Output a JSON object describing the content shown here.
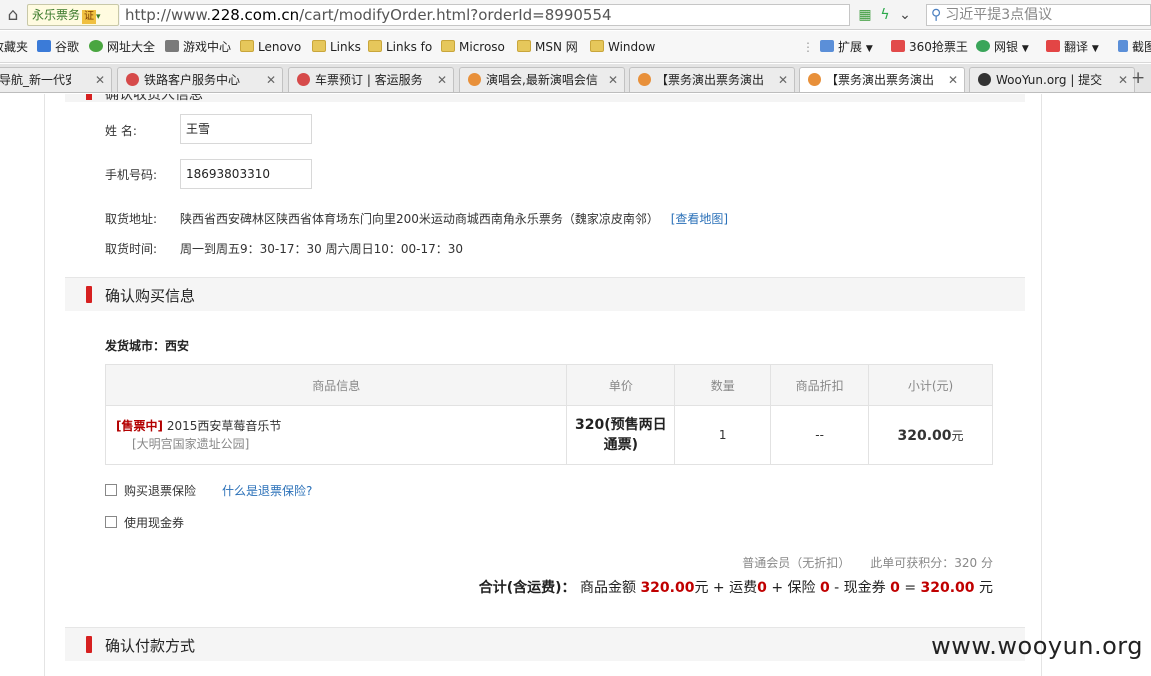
{
  "browser": {
    "site_badge": "永乐票务",
    "cert_label": "证",
    "url_prefix": "http://www.",
    "url_host": "228.com.cn",
    "url_path": "/cart/modifyOrder.html?orderId=8990554",
    "search_text": "习近平提3点倡议",
    "bookmarks": [
      {
        "label": "收藏夹",
        "icon": "star-icon"
      },
      {
        "label": "谷歌",
        "icon": "google-icon"
      },
      {
        "label": "网址大全",
        "icon": "site-nav-icon"
      },
      {
        "label": "游戏中心",
        "icon": "game-icon"
      },
      {
        "label": "Lenovo",
        "icon": "folder-icon"
      },
      {
        "label": "Links",
        "icon": "folder-icon"
      },
      {
        "label": "Links fo",
        "icon": "folder-icon"
      },
      {
        "label": "Microso",
        "icon": "folder-icon"
      },
      {
        "label": "MSN 网",
        "icon": "folder-icon"
      },
      {
        "label": "Window",
        "icon": "folder-icon"
      }
    ],
    "bookmark_tools": [
      {
        "label": "扩展",
        "icon": "extension-icon"
      },
      {
        "label": "360抢票王",
        "icon": "ticket-icon"
      },
      {
        "label": "网银",
        "icon": "bank-icon"
      },
      {
        "label": "翻译",
        "icon": "translate-icon"
      },
      {
        "label": "截图",
        "icon": "screenshot-icon"
      }
    ],
    "tabs": [
      {
        "label": "导航_新一代安全",
        "active": false,
        "color": "#3b7bd8"
      },
      {
        "label": "铁路客户服务中心",
        "active": false,
        "color": "#d64a4a"
      },
      {
        "label": "车票预订 | 客运服务",
        "active": false,
        "color": "#d64a4a"
      },
      {
        "label": "演唱会,最新演唱会信",
        "active": false,
        "color": "#e8903a"
      },
      {
        "label": "【票务演出票务演出",
        "active": false,
        "color": "#e8903a"
      },
      {
        "label": "【票务演出票务演出",
        "active": true,
        "color": "#e8903a"
      },
      {
        "label": "WooYun.org | 提交",
        "active": false,
        "color": "#333333"
      }
    ]
  },
  "cut_section": {
    "title": "确认收货人信息"
  },
  "pickup": {
    "name_label": "姓    名:",
    "name_value": "王雪",
    "phone_label": "手机号码:",
    "phone_value": "18693803310",
    "address_label": "取货地址:",
    "address_value": "陕西省西安碑林区陕西省体育场东门向里200米运动商城西南角永乐票务（魏家凉皮南邻）",
    "map_link": "[查看地图]",
    "time_label": "取货时间:",
    "time_value": "周一到周五9：30-17：30 周六周日10：00-17：30"
  },
  "purchase_section": {
    "title": "确认购买信息"
  },
  "shipping_city": "发货城市：西安",
  "table": {
    "headers": [
      "商品信息",
      "单价",
      "数量",
      "商品折扣",
      "小计(元)"
    ],
    "rows": [
      {
        "status": "[售票中]",
        "name": "2015西安草莓音乐节",
        "venue": "[大明宫国家遗址公园]",
        "price_line1": "320(预售两日",
        "price_line2": "通票)",
        "qty": "1",
        "discount": "--",
        "subtotal": "320.00",
        "subtotal_unit": "元"
      }
    ]
  },
  "options": {
    "insurance_label": "购买退票保险",
    "insurance_help": "什么是退票保险?",
    "voucher_label": "使用现金券"
  },
  "summary": {
    "member": "普通会员（无折扣）",
    "points": "此单可获积分：320 分",
    "total_label": "合计(含运费)：",
    "goods_label": "商品金额",
    "goods_amount": "320.00",
    "yuan": "元",
    "plus1": "+",
    "shipping_label": "运费",
    "shipping_amount": "0",
    "plus2": "+",
    "insurance_label": "保险",
    "insurance_amount": "0",
    "minus": "-",
    "voucher_label": "现金券",
    "voucher_amount": "0",
    "equals": "=",
    "final_amount": "320.00",
    "final_unit": "元"
  },
  "payment_section": {
    "title": "确认付款方式"
  },
  "watermark": "www.wooyun.org"
}
